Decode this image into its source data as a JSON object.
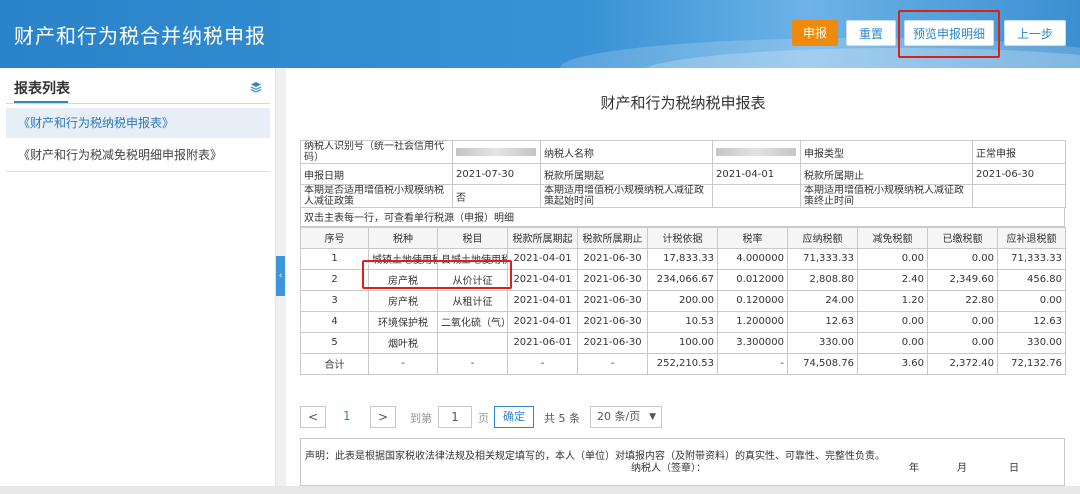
{
  "app": {
    "title": "财产和行为税合并纳税申报"
  },
  "toolbar": {
    "declare": "申报",
    "reset": "重置",
    "preview": "预览申报明细",
    "prev": "上一步"
  },
  "sidebar": {
    "title": "报表列表",
    "items": [
      {
        "label": "《财产和行为税纳税申报表》",
        "active": true
      },
      {
        "label": "《财产和行为税减免税明细申报附表》",
        "active": false
      }
    ]
  },
  "form": {
    "title": "财产和行为税纳税申报表",
    "info": {
      "taxpayer_id_label": "纳税人识别号（统一社会信用代码）",
      "taxpayer_name_label": "纳税人名称",
      "declare_type_label": "申报类型",
      "declare_type_value": "正常申报",
      "declare_date_label": "申报日期",
      "declare_date_value": "2021-07-30",
      "period_start_label": "税款所属期起",
      "period_start_value": "2021-04-01",
      "period_end_label": "税款所属期止",
      "period_end_value": "2021-06-30",
      "small_scale_label": "本期是否适用增值税小规模纳税人减征政策",
      "small_scale_value": "否",
      "policy_start_label": "本期适用增值税小规模纳税人减征政策起始时间",
      "policy_end_label": "本期适用增值税小规模纳税人减征政策终止时间"
    },
    "note": "双击主表每一行，可查看单行税源（申报）明细",
    "columns": [
      "序号",
      "税种",
      "税目",
      "税款所属期起",
      "税款所属期止",
      "计税依据",
      "税率",
      "应纳税额",
      "减免税额",
      "已缴税额",
      "应补退税额"
    ],
    "rows": [
      [
        "1",
        "城镇土地使用税",
        "县城土地使用税",
        "2021-04-01",
        "2021-06-30",
        "17,833.33",
        "4.000000",
        "71,333.33",
        "0.00",
        "0.00",
        "71,333.33"
      ],
      [
        "2",
        "房产税",
        "从价计征",
        "2021-04-01",
        "2021-06-30",
        "234,066.67",
        "0.012000",
        "2,808.80",
        "2.40",
        "2,349.60",
        "456.80"
      ],
      [
        "3",
        "房产税",
        "从租计征",
        "2021-04-01",
        "2021-06-30",
        "200.00",
        "0.120000",
        "24.00",
        "1.20",
        "22.80",
        "0.00"
      ],
      [
        "4",
        "环境保护税",
        "二氧化硫（气）",
        "2021-04-01",
        "2021-06-30",
        "10.53",
        "1.200000",
        "12.63",
        "0.00",
        "0.00",
        "12.63"
      ],
      [
        "5",
        "烟叶税",
        "",
        "2021-06-01",
        "2021-06-30",
        "100.00",
        "3.300000",
        "330.00",
        "0.00",
        "0.00",
        "330.00"
      ]
    ],
    "total": [
      "合计",
      "-",
      "-",
      "-",
      "-",
      "252,210.53",
      "-",
      "74,508.76",
      "3.60",
      "2,372.40",
      "72,132.76"
    ]
  },
  "pager": {
    "prev": "<",
    "current": "1",
    "next": ">",
    "goto_label": "到第",
    "goto_value": "1",
    "page_unit": "页",
    "confirm": "确定",
    "total": "共 5 条",
    "page_size": "20 条/页"
  },
  "declaration": {
    "text": "声明：此表是根据国家税收法律法规及相关规定填写的，本人（单位）对填报内容（及附带资料）的真实性、可靠性、完整性负责。",
    "signer": "纳税人（签章）：",
    "year": "年",
    "month": "月",
    "day": "日"
  }
}
